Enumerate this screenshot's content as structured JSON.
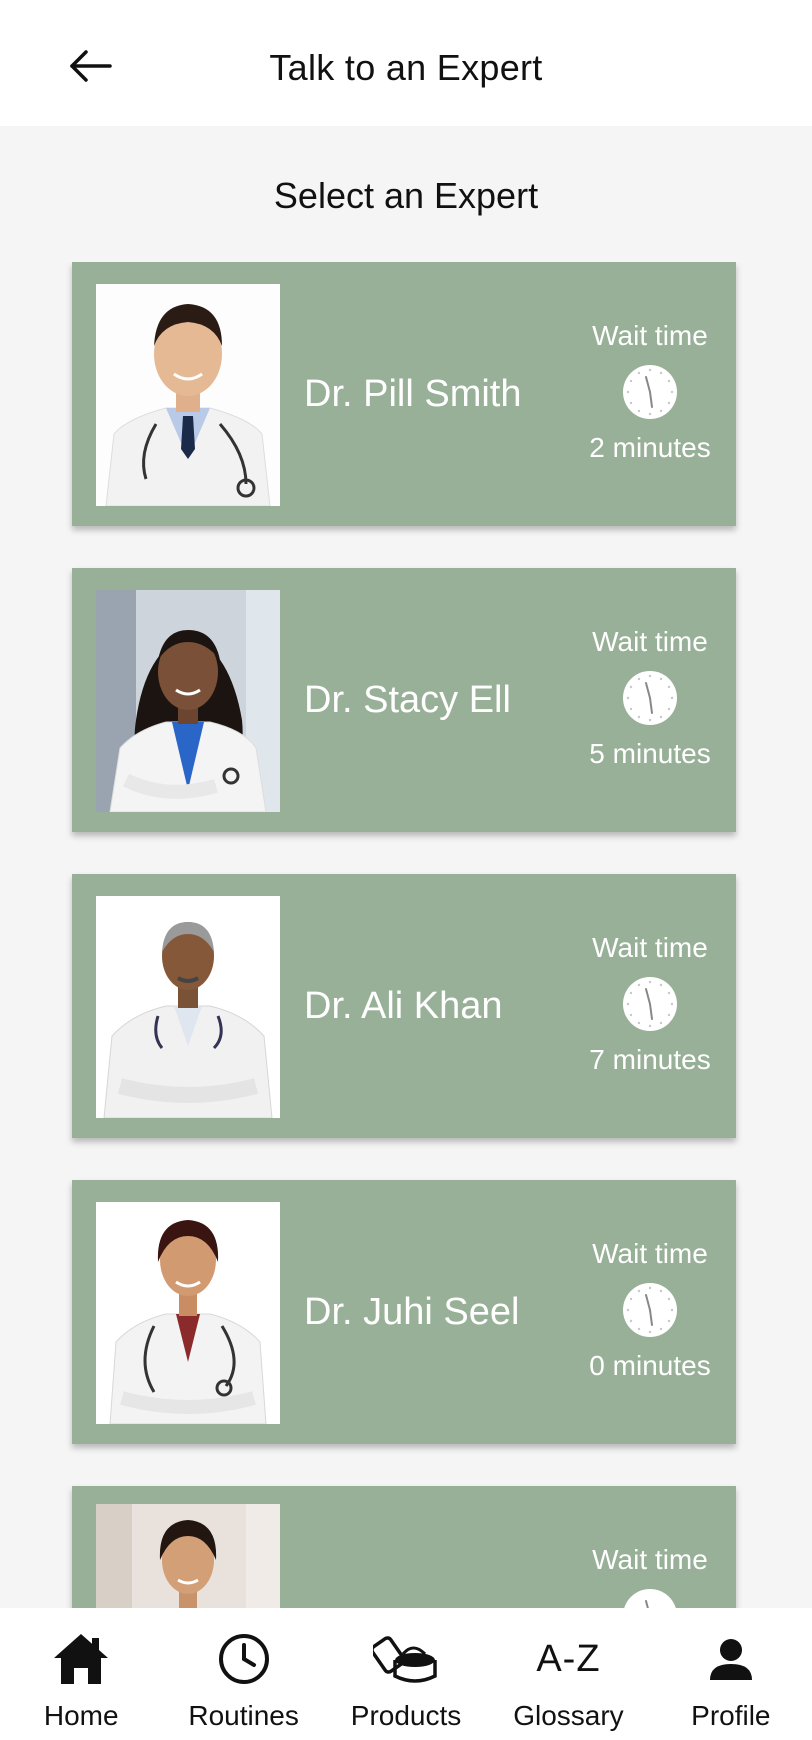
{
  "header": {
    "title": "Talk to an Expert",
    "back_icon": "arrow-left-icon"
  },
  "page": {
    "subtitle": "Select an Expert"
  },
  "theme": {
    "card_color": "#98b097",
    "background": "#f5f5f5"
  },
  "experts": [
    {
      "name": "Dr. Pill Smith",
      "wait_label": "Wait time",
      "wait_value": "2 minutes"
    },
    {
      "name": "Dr. Stacy Ell",
      "wait_label": "Wait time",
      "wait_value": "5 minutes"
    },
    {
      "name": "Dr. Ali Khan",
      "wait_label": "Wait time",
      "wait_value": "7 minutes"
    },
    {
      "name": "Dr. Juhi Seel",
      "wait_label": "Wait time",
      "wait_value": "0 minutes"
    },
    {
      "name": "",
      "wait_label": "Wait time",
      "wait_value": ""
    }
  ],
  "nav": {
    "items": [
      {
        "label": "Home",
        "icon": "home-icon"
      },
      {
        "label": "Routines",
        "icon": "clock-icon"
      },
      {
        "label": "Products",
        "icon": "products-icon"
      },
      {
        "label": "Glossary",
        "icon": "a-z-icon",
        "icon_text": "A-Z"
      },
      {
        "label": "Profile",
        "icon": "person-icon"
      }
    ]
  }
}
